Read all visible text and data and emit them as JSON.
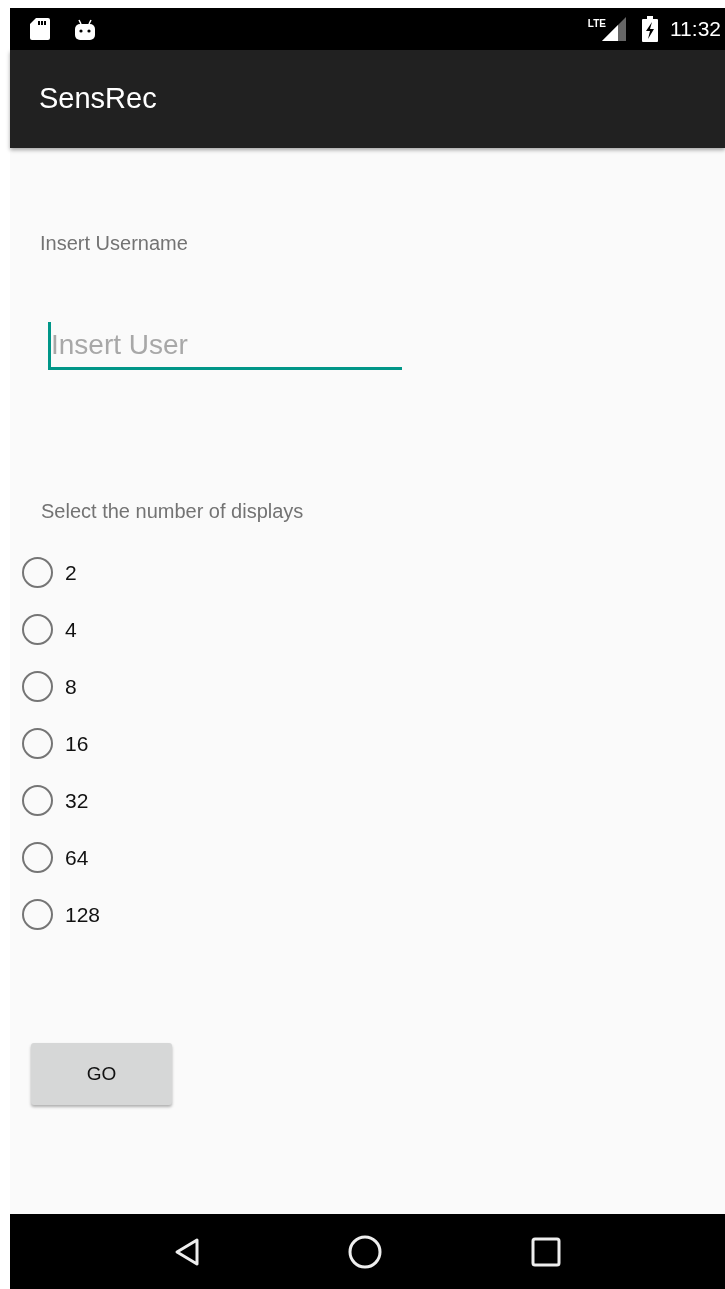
{
  "status_bar": {
    "network": "LTE",
    "time": "11:32"
  },
  "app_bar": {
    "title": "SensRec"
  },
  "username_label": "Insert Username",
  "username_field": {
    "placeholder": "Insert User",
    "focused": true
  },
  "displays_label": "Select the number of displays",
  "display_options": [
    {
      "label": "2",
      "selected": false
    },
    {
      "label": "4",
      "selected": false
    },
    {
      "label": "8",
      "selected": false
    },
    {
      "label": "16",
      "selected": false
    },
    {
      "label": "32",
      "selected": false
    },
    {
      "label": "64",
      "selected": false
    },
    {
      "label": "128",
      "selected": false
    }
  ],
  "go_button": {
    "label": "GO"
  }
}
